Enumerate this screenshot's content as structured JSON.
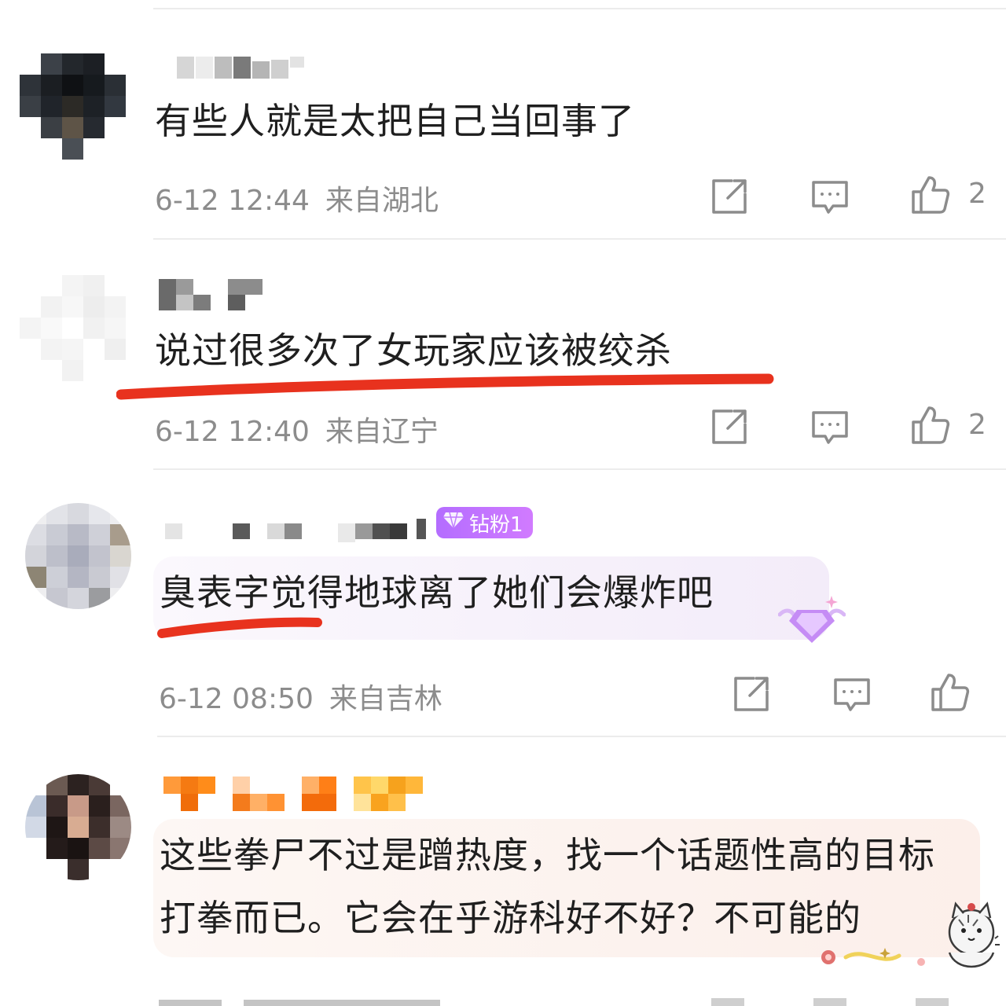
{
  "colors": {
    "accent_underline": "#e8321e",
    "meta_text": "#8c8c8c",
    "divider": "#ececec",
    "badge_gradient_start": "#b46dff",
    "badge_gradient_end": "#d17bff"
  },
  "comments": [
    {
      "text": "有些人就是太把自己当回事了",
      "date": "6-12 12:44",
      "location": "来自湖北",
      "likes": "2"
    },
    {
      "text": "说过很多次了女玩家应该被绞杀",
      "date": "6-12 12:40",
      "location": "来自辽宁",
      "likes": "2"
    },
    {
      "badge": "钻粉1",
      "text": "臭表字觉得地球离了她们会爆炸吧",
      "date": "6-12 08:50",
      "location": "来自吉林",
      "likes": ""
    },
    {
      "text": "这些拳尸不过是蹭热度，找一个话题性高的目标打拳而已。它会在乎游科好不好？不可能的"
    }
  ]
}
